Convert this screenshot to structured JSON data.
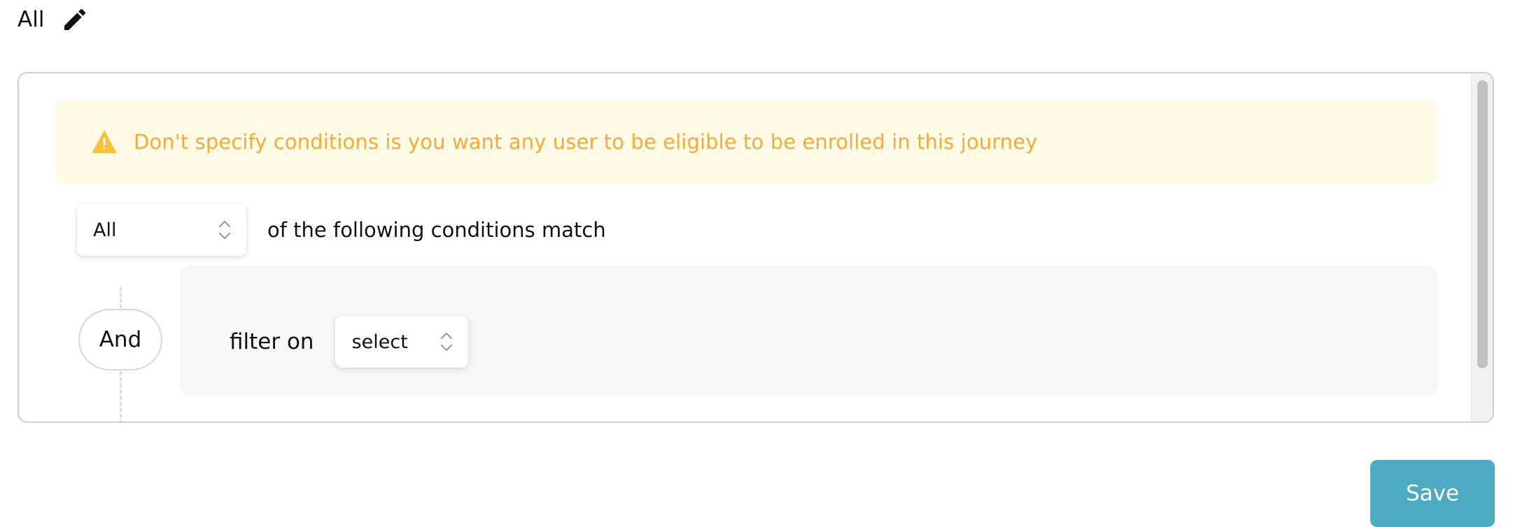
{
  "header": {
    "title": "All",
    "edit_icon": "pencil-icon"
  },
  "alert": {
    "icon": "warning-icon",
    "text": "Don't specify conditions is you want any user to be eligible to be enrolled in this journey",
    "color": "#f5ab36",
    "background": "#fffbe7"
  },
  "match": {
    "selected": "All",
    "suffix": "of the following conditions match"
  },
  "condition": {
    "operator": "And",
    "filter_label": "filter on",
    "filter_selected": "select"
  },
  "actions": {
    "save_label": "Save",
    "save_color": "#4eaac1"
  }
}
